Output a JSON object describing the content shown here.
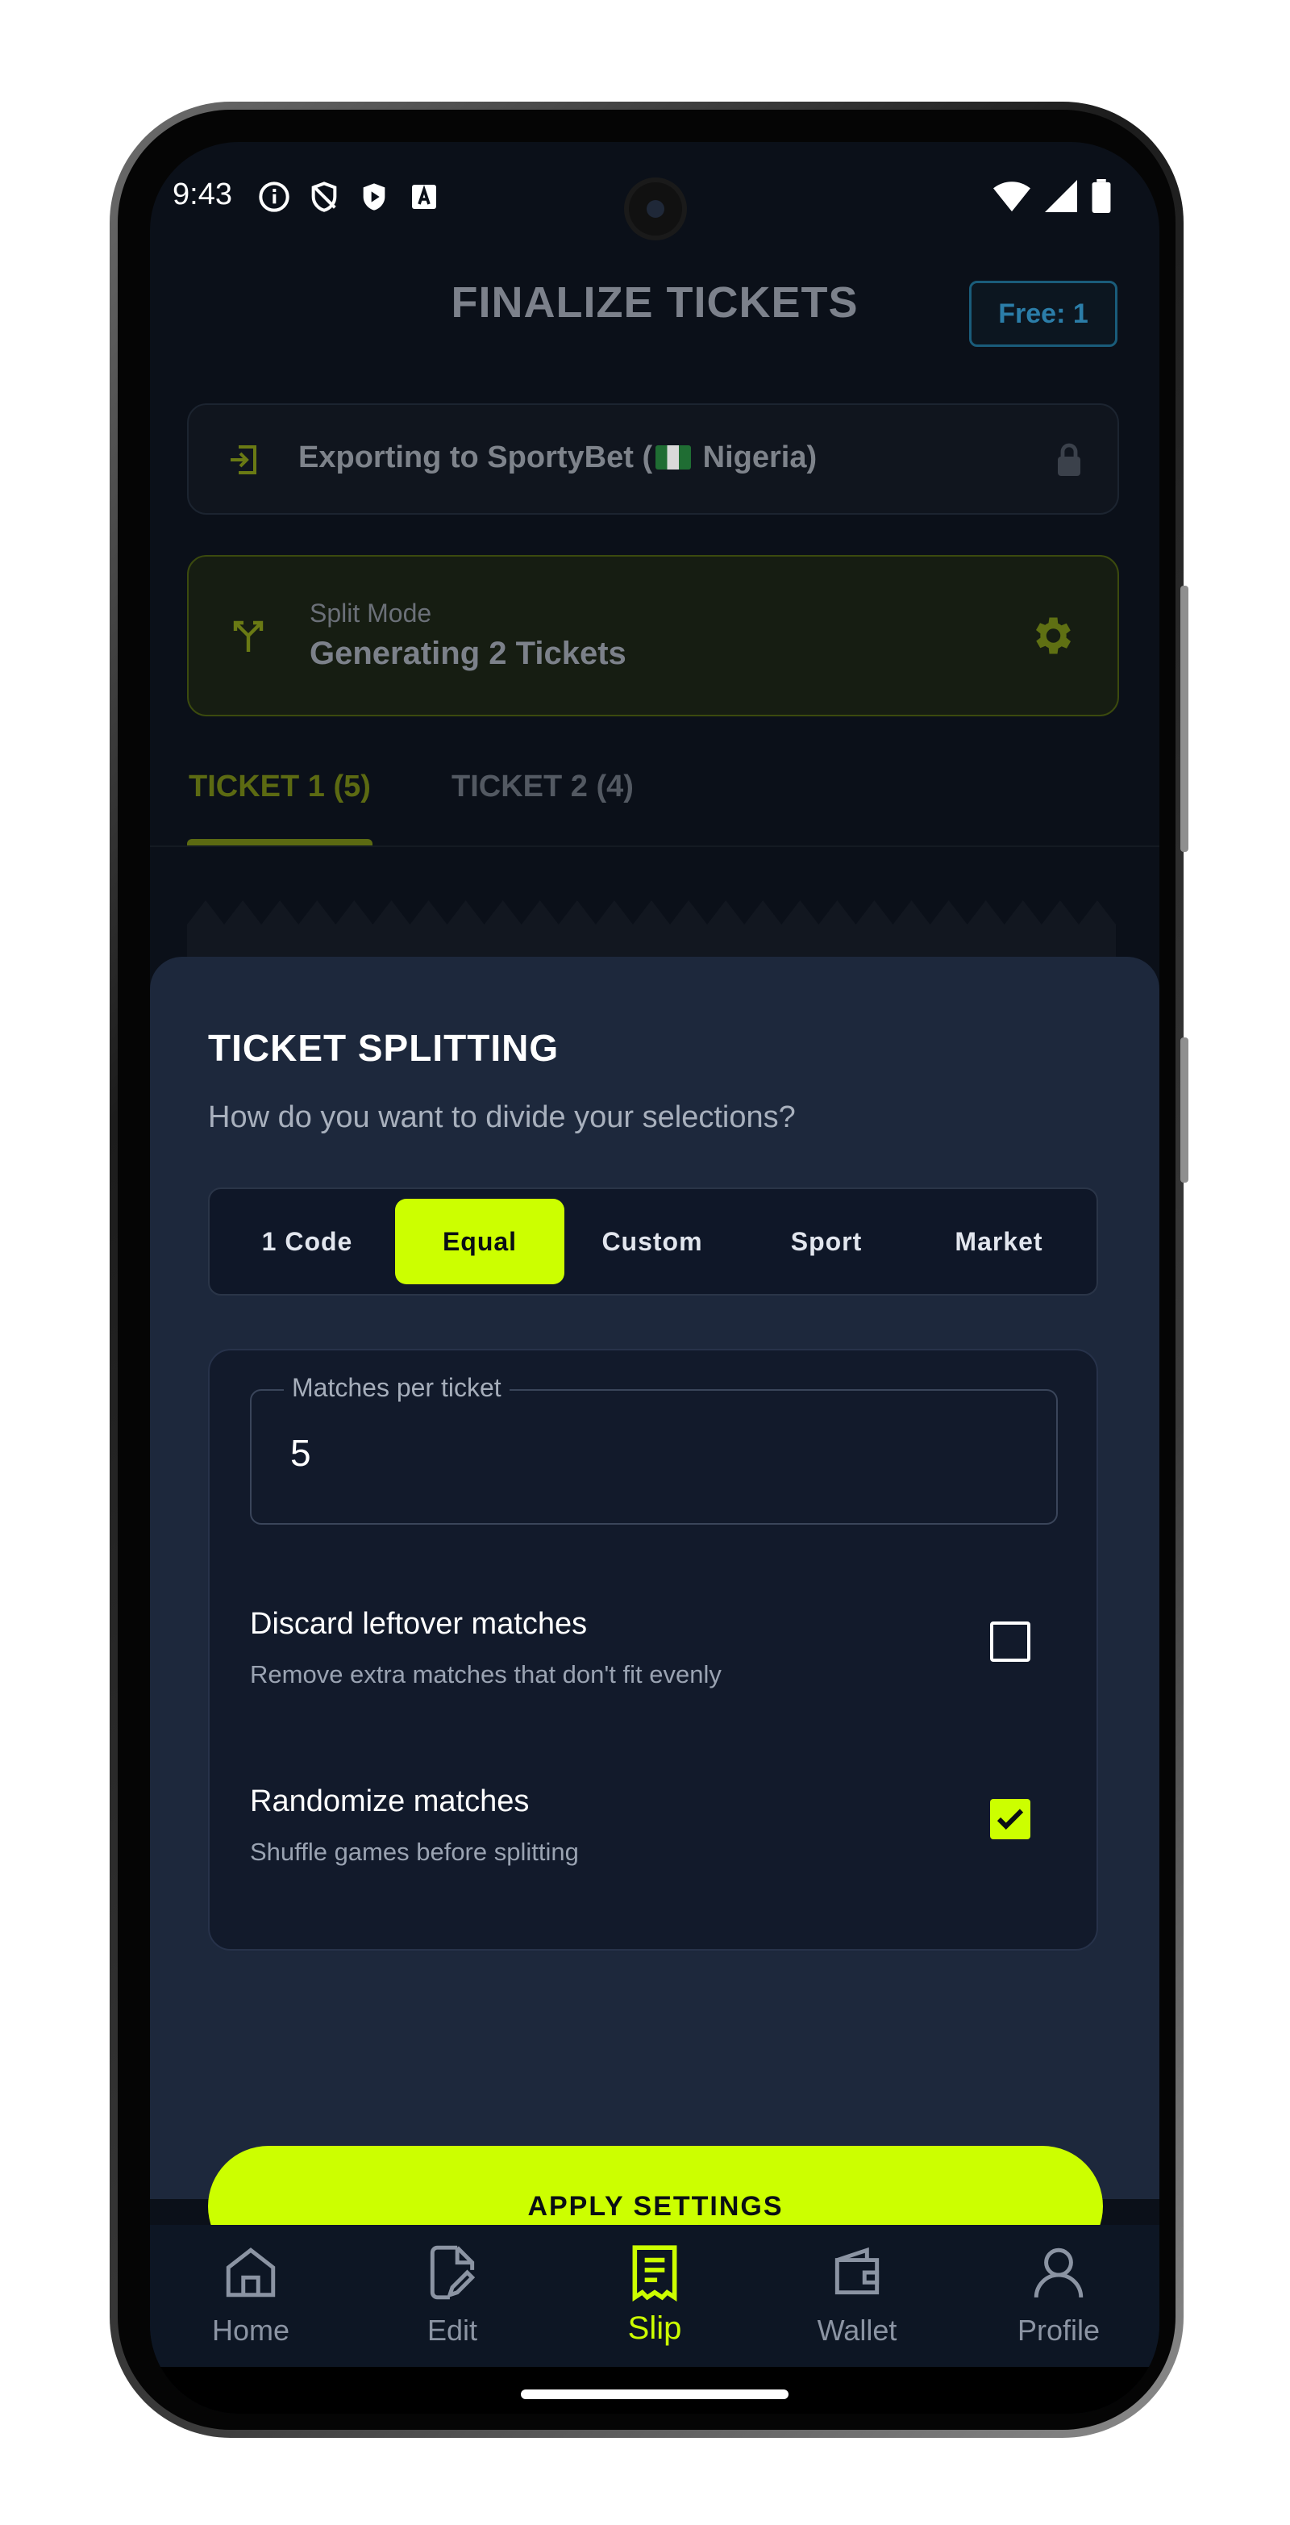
{
  "status_bar": {
    "time": "9:43"
  },
  "header": {
    "title": "FINALIZE TICKETS",
    "free_badge": "Free: 1"
  },
  "export": {
    "text_prefix": "Exporting to SportyBet (",
    "country": "Nigeria)"
  },
  "split_mode": {
    "label": "Split Mode",
    "value": "Generating 2 Tickets"
  },
  "tabs": [
    {
      "label": "TICKET 1 (5)"
    },
    {
      "label": "TICKET 2 (4)"
    }
  ],
  "sheet": {
    "title": "TICKET SPLITTING",
    "subtitle": "How do you want to divide your selections?",
    "modes": [
      "1 Code",
      "Equal",
      "Custom",
      "Sport",
      "Market"
    ],
    "selected_mode": "Equal",
    "matches_field": {
      "label": "Matches per ticket",
      "value": "5"
    },
    "options": [
      {
        "title": "Discard leftover matches",
        "subtitle": "Remove extra matches that don't fit evenly",
        "checked": false
      },
      {
        "title": "Randomize matches",
        "subtitle": "Shuffle games before splitting",
        "checked": true
      }
    ],
    "apply_label": "APPLY SETTINGS"
  },
  "nav": [
    {
      "label": "Home",
      "icon": "home-icon"
    },
    {
      "label": "Edit",
      "icon": "edit-icon"
    },
    {
      "label": "Slip",
      "icon": "receipt-icon",
      "active": true
    },
    {
      "label": "Wallet",
      "icon": "wallet-icon"
    },
    {
      "label": "Profile",
      "icon": "profile-icon"
    }
  ],
  "colors": {
    "accent": "#ccff00",
    "background": "#0b1019",
    "sheet": "#1d283c"
  }
}
